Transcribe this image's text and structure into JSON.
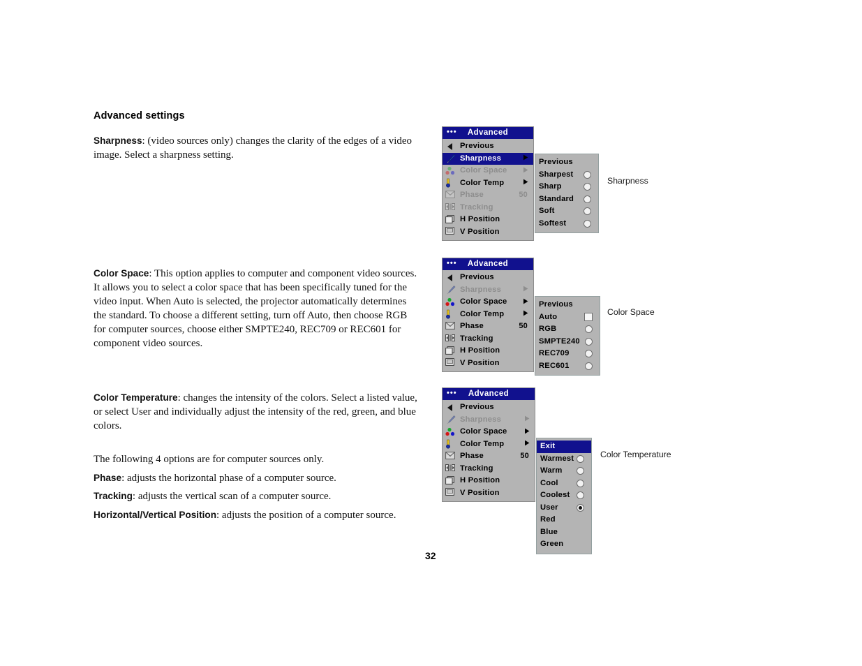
{
  "document": {
    "heading": "Advanced settings",
    "page_number": "32"
  },
  "body": {
    "sharpness_term": "Sharpness",
    "sharpness_text": ": (video sources only) changes the clarity of the edges of a video image. Select a sharpness setting.",
    "colorspace_term": "Color Space",
    "colorspace_text": ": This option applies to computer and component video sources. It allows you to select a color space that has been specifically tuned for the video input. When Auto is selected, the projector automatically determines the standard. To choose a different setting, turn off Auto, then choose RGB for computer sources, choose either SMPTE240, REC709 or REC601 for component video sources.",
    "colortemp_term": "Color Temperature",
    "colortemp_text": ": changes the intensity of the colors. Select a listed value, or select User and individually adjust the intensity of the red, green, and blue colors.",
    "note_text": "The following 4 options are for computer sources only.",
    "phase_term": "Phase",
    "phase_text": ": adjusts the horizontal phase of a computer source.",
    "tracking_term": "Tracking",
    "tracking_text": ": adjusts the vertical scan of a computer source.",
    "hv_term": "Horizontal/Vertical Position",
    "hv_text": ": adjusts the position of a computer source."
  },
  "colors": {
    "title_bar": "#11118e",
    "menu_bg": "#b4b4b4",
    "highlight": "#11118e",
    "disabled_text": "#8d8d8d"
  },
  "menus": [
    {
      "id": "menu-sharpness",
      "title": "Advanced",
      "title_dots": "•••",
      "caption": "Sharpness",
      "items": [
        {
          "label": "Previous",
          "icon": "previous-arrow-icon",
          "arrow": false,
          "value": "",
          "state": "normal"
        },
        {
          "label": "Sharpness",
          "icon": "pen-icon",
          "arrow": true,
          "value": "",
          "state": "selected"
        },
        {
          "label": "Color Space",
          "icon": "color-dots-icon",
          "arrow": true,
          "value": "",
          "state": "disabled"
        },
        {
          "label": "Color Temp",
          "icon": "thermometer-icon",
          "arrow": true,
          "value": "",
          "state": "normal"
        },
        {
          "label": "Phase",
          "icon": "phase-icon",
          "arrow": false,
          "value": "50",
          "state": "disabled"
        },
        {
          "label": "Tracking",
          "icon": "tracking-icon",
          "arrow": false,
          "value": "",
          "state": "disabled"
        },
        {
          "label": "H Position",
          "icon": "h-position-icon",
          "arrow": false,
          "value": "",
          "state": "normal"
        },
        {
          "label": "V Position",
          "icon": "v-position-icon",
          "arrow": false,
          "value": "",
          "state": "normal"
        }
      ],
      "submenu": [
        {
          "label": "Previous",
          "control": "none",
          "selected": false
        },
        {
          "label": "Sharpest",
          "control": "radio",
          "selected": false
        },
        {
          "label": "Sharp",
          "control": "radio",
          "selected": false
        },
        {
          "label": "Standard",
          "control": "radio",
          "selected": false
        },
        {
          "label": "Soft",
          "control": "radio",
          "selected": false
        },
        {
          "label": "Softest",
          "control": "radio",
          "selected": false
        }
      ]
    },
    {
      "id": "menu-colorspace",
      "title": "Advanced",
      "title_dots": "•••",
      "caption": "Color Space",
      "items": [
        {
          "label": "Previous",
          "icon": "previous-arrow-icon",
          "arrow": false,
          "value": "",
          "state": "normal"
        },
        {
          "label": "Sharpness",
          "icon": "pen-icon",
          "arrow": true,
          "value": "",
          "state": "disabled"
        },
        {
          "label": "Color Space",
          "icon": "color-dots-icon",
          "arrow": true,
          "value": "",
          "state": "normal"
        },
        {
          "label": "Color Temp",
          "icon": "thermometer-icon",
          "arrow": true,
          "value": "",
          "state": "normal"
        },
        {
          "label": "Phase",
          "icon": "phase-icon",
          "arrow": false,
          "value": "50",
          "state": "normal"
        },
        {
          "label": "Tracking",
          "icon": "tracking-icon",
          "arrow": false,
          "value": "",
          "state": "normal"
        },
        {
          "label": "H Position",
          "icon": "h-position-icon",
          "arrow": false,
          "value": "",
          "state": "normal"
        },
        {
          "label": "V Position",
          "icon": "v-position-icon",
          "arrow": false,
          "value": "",
          "state": "normal"
        }
      ],
      "submenu": [
        {
          "label": "Previous",
          "control": "none",
          "selected": false
        },
        {
          "label": "Auto",
          "control": "checkbox",
          "selected": false
        },
        {
          "label": "RGB",
          "control": "radio",
          "selected": false
        },
        {
          "label": "SMPTE240",
          "control": "radio",
          "selected": false
        },
        {
          "label": "REC709",
          "control": "radio",
          "selected": false
        },
        {
          "label": "REC601",
          "control": "radio",
          "selected": false
        }
      ]
    },
    {
      "id": "menu-colortemp",
      "title": "Advanced",
      "title_dots": "•••",
      "caption": "Color Temperature",
      "items": [
        {
          "label": "Previous",
          "icon": "previous-arrow-icon",
          "arrow": false,
          "value": "",
          "state": "normal"
        },
        {
          "label": "Sharpness",
          "icon": "pen-icon",
          "arrow": true,
          "value": "",
          "state": "disabled"
        },
        {
          "label": "Color Space",
          "icon": "color-dots-icon",
          "arrow": true,
          "value": "",
          "state": "normal"
        },
        {
          "label": "Color Temp",
          "icon": "thermometer-icon",
          "arrow": true,
          "value": "",
          "state": "normal"
        },
        {
          "label": "Phase",
          "icon": "phase-icon",
          "arrow": false,
          "value": "50",
          "state": "normal"
        },
        {
          "label": "Tracking",
          "icon": "tracking-icon",
          "arrow": false,
          "value": "",
          "state": "normal"
        },
        {
          "label": "H Position",
          "icon": "h-position-icon",
          "arrow": false,
          "value": "",
          "state": "normal"
        },
        {
          "label": "V Position",
          "icon": "v-position-icon",
          "arrow": false,
          "value": "",
          "state": "normal"
        }
      ],
      "submenu": [
        {
          "label": "Exit",
          "control": "none",
          "selected": true
        },
        {
          "label": "Warmest",
          "control": "radio",
          "selected": false
        },
        {
          "label": "Warm",
          "control": "radio",
          "selected": false
        },
        {
          "label": "Cool",
          "control": "radio",
          "selected": false
        },
        {
          "label": "Coolest",
          "control": "radio",
          "selected": false
        },
        {
          "label": "User",
          "control": "radio",
          "selected": true
        },
        {
          "label": "Red",
          "control": "none",
          "selected": false
        },
        {
          "label": "Blue",
          "control": "none",
          "selected": false
        },
        {
          "label": "Green",
          "control": "none",
          "selected": false
        }
      ]
    }
  ]
}
